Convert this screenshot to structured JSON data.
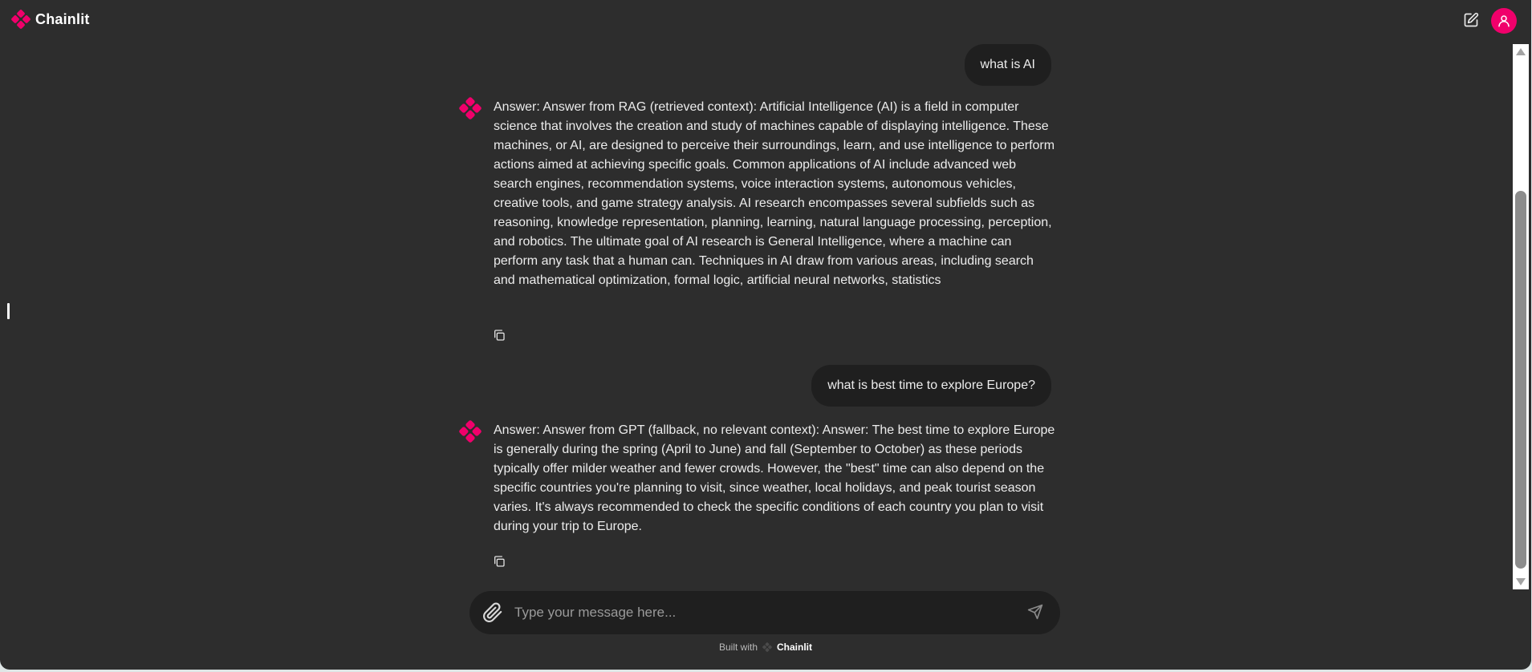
{
  "header": {
    "brand_name": "Chainlit",
    "brand_color": "#f0006b",
    "new_chat_icon": "edit-icon",
    "avatar_icon": "user-icon"
  },
  "conversation": {
    "messages": [
      {
        "role": "user",
        "text": "what is AI"
      },
      {
        "role": "assistant",
        "text": "Answer: Answer from RAG (retrieved context): Artificial Intelligence (AI) is a field in computer science that involves the creation and study of machines capable of displaying intelligence. These machines, or AI, are designed to perceive their surroundings, learn, and use intelligence to perform actions aimed at achieving specific goals. Common applications of AI include advanced web search engines, recommendation systems, voice interaction systems, autonomous vehicles, creative tools, and game strategy analysis. AI research encompasses several subfields such as reasoning, knowledge representation, planning, learning, natural language processing, perception, and robotics. The ultimate goal of AI research is General Intelligence, where a machine can perform any task that a human can. Techniques in AI draw from various areas, including search and mathematical optimization, formal logic, artificial neural networks, statistics"
      },
      {
        "role": "user",
        "text": "what is best time to explore Europe?"
      },
      {
        "role": "assistant",
        "text": "Answer: Answer from GPT (fallback, no relevant context): Answer: The best time to explore Europe is generally during the spring (April to June) and fall (September to October) as these periods typically offer milder weather and fewer crowds. However, the \"best\" time can also depend on the specific countries you're planning to visit, since weather, local holidays, and peak tourist season varies. It's always recommended to check the specific conditions of each country you plan to visit during your trip to Europe."
      }
    ]
  },
  "composer": {
    "placeholder": "Type your message here...",
    "value": "",
    "attach_icon": "paperclip-icon",
    "send_icon": "send-icon"
  },
  "footer": {
    "built_with": "Built with",
    "brand": "Chainlit"
  }
}
